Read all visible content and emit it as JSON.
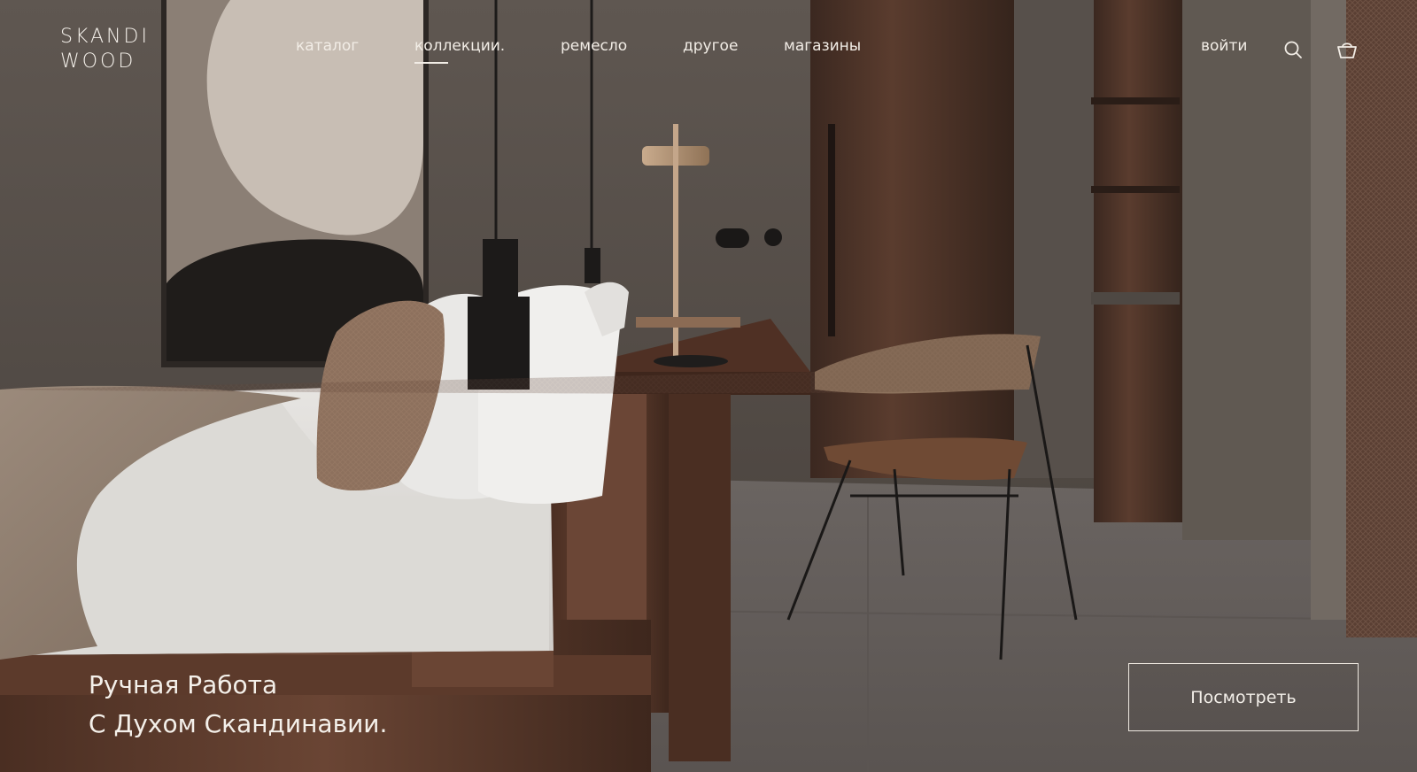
{
  "brand": {
    "line1": "SKANDI",
    "line2": "WOOD"
  },
  "nav": {
    "items": [
      {
        "label": "каталог"
      },
      {
        "label": "коллекции."
      },
      {
        "label": "ремесло"
      },
      {
        "label": "другое"
      },
      {
        "label": "магазины"
      }
    ],
    "active_index": 1,
    "login_label": "войти"
  },
  "icons": {
    "search": "search-icon",
    "cart": "basket-icon"
  },
  "hero": {
    "headline_line1": "Ручная Работа",
    "headline_line2": "С Духом Скандинавии.",
    "cta_label": "Посмотреть"
  },
  "colors": {
    "text": "#f3efe9",
    "wall": "#5a534d",
    "walnut": "#5b3b2c"
  }
}
